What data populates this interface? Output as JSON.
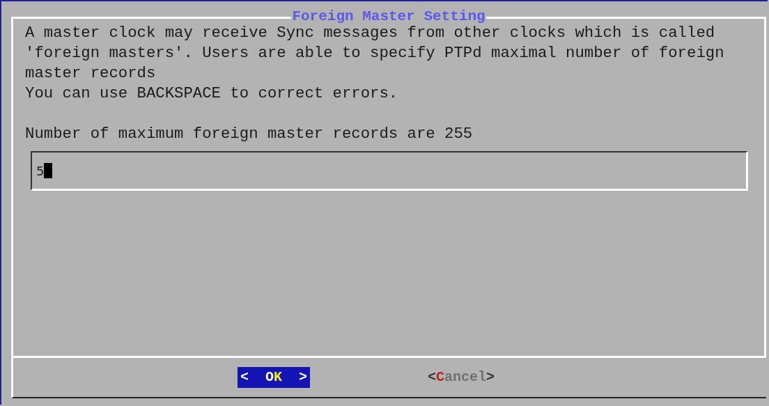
{
  "dialog": {
    "title": "Foreign Master Setting",
    "message": [
      "A master clock may receive Sync messages from other clocks which is called",
      "'foreign masters'. Users are able to specify PTPd maximal number of foreign",
      "master records",
      "You can use BACKSPACE to correct errors."
    ],
    "limit_text": "Number of maximum foreign master records are 255",
    "input": {
      "value": "5"
    },
    "buttons": [
      {
        "left": "<",
        "hotkey": "O",
        "rest": "K",
        "right": ">",
        "selected": true
      },
      {
        "left": "<",
        "hotkey": "C",
        "rest": "ancel",
        "right": ">",
        "selected": false
      }
    ]
  }
}
